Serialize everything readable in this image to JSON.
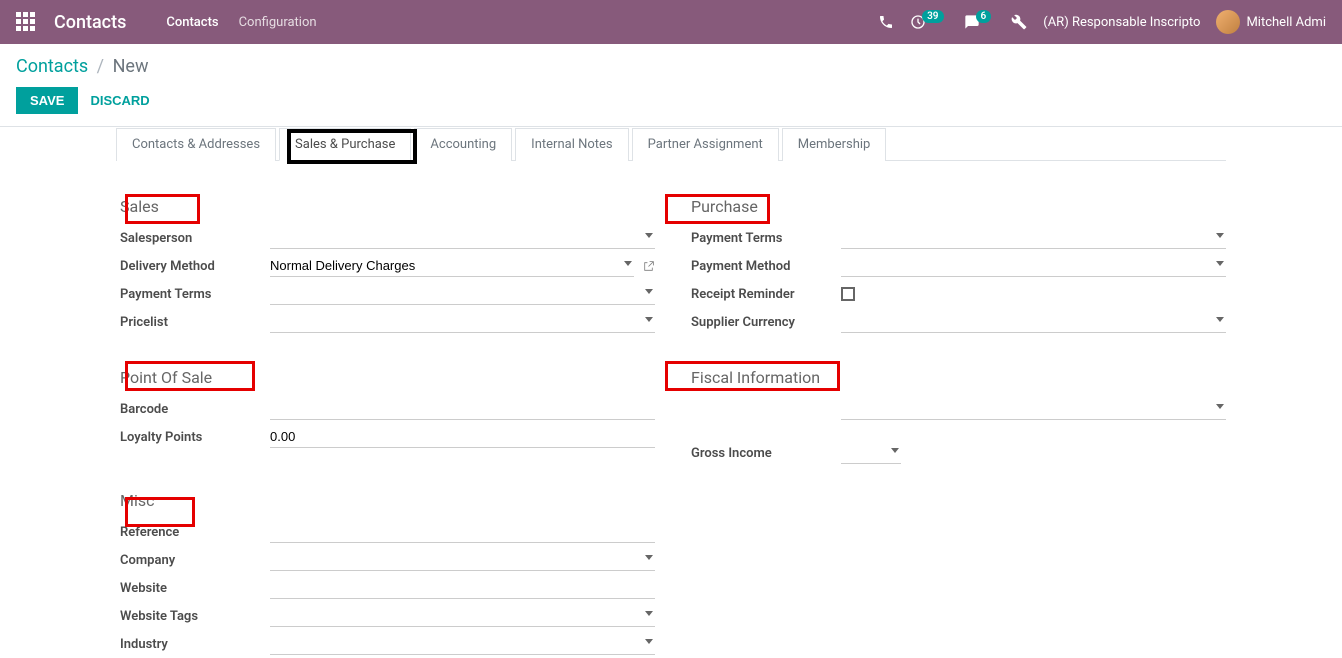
{
  "navbar": {
    "app_title": "Contacts",
    "links": [
      "Contacts",
      "Configuration"
    ],
    "badge_clock": "39",
    "badge_chat": "6",
    "company_label": "(AR) Responsable Inscripto",
    "user_name": "Mitchell Admi"
  },
  "breadcrumb": {
    "root": "Contacts",
    "current": "New"
  },
  "buttons": {
    "save": "Save",
    "discard": "Discard"
  },
  "tabs": [
    "Contacts & Addresses",
    "Sales & Purchase",
    "Accounting",
    "Internal Notes",
    "Partner Assignment",
    "Membership"
  ],
  "sections": {
    "sales": {
      "title": "Sales",
      "salesperson_label": "Salesperson",
      "salesperson_value": "",
      "delivery_method_label": "Delivery Method",
      "delivery_method_value": "Normal Delivery Charges",
      "payment_terms_label": "Payment Terms",
      "payment_terms_value": "",
      "pricelist_label": "Pricelist",
      "pricelist_value": ""
    },
    "pos": {
      "title": "Point Of Sale",
      "barcode_label": "Barcode",
      "barcode_value": "",
      "loyalty_label": "Loyalty Points",
      "loyalty_value": "0.00"
    },
    "misc": {
      "title": "Misc",
      "reference_label": "Reference",
      "reference_value": "",
      "company_label": "Company",
      "company_value": "",
      "website_label": "Website",
      "website_value": "",
      "website_tags_label": "Website Tags",
      "website_tags_value": "",
      "industry_label": "Industry",
      "industry_value": ""
    },
    "purchase": {
      "title": "Purchase",
      "payment_terms_label": "Payment Terms",
      "payment_terms_value": "",
      "payment_method_label": "Payment Method",
      "payment_method_value": "",
      "receipt_reminder_label": "Receipt Reminder",
      "supplier_currency_label": "Supplier Currency",
      "supplier_currency_value": ""
    },
    "fiscal": {
      "title": "Fiscal Information",
      "top_value": "",
      "gross_income_label": "Gross Income",
      "gross_income_value": ""
    }
  }
}
